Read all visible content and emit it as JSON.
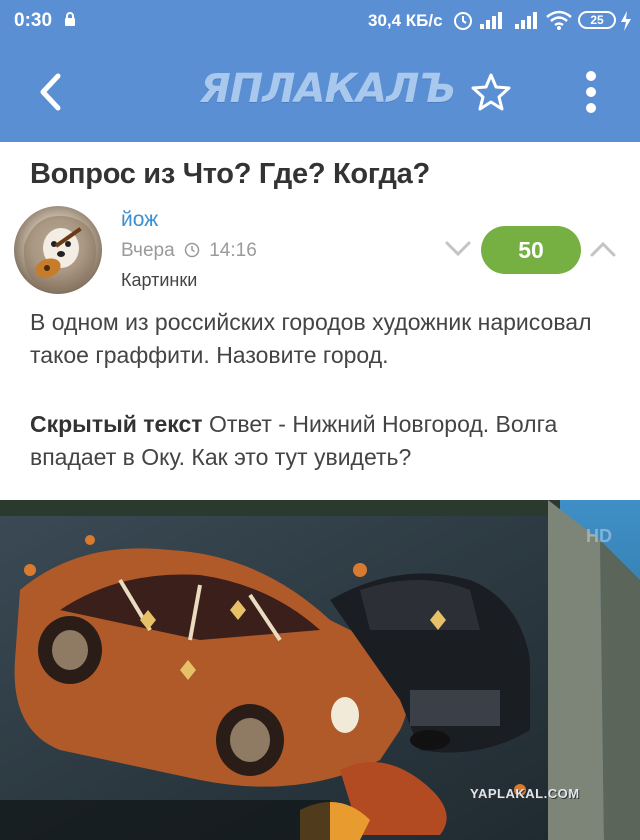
{
  "status_bar": {
    "time": "0:30",
    "speed": "30,4 КБ/с",
    "battery": "25",
    "icons": [
      "lock-icon",
      "alarm-icon",
      "signal-icon",
      "signal-icon",
      "wifi-icon",
      "battery-icon",
      "charging-icon"
    ]
  },
  "app_bar": {
    "logo": "ЯПЛАКАЛЪ",
    "icons": [
      "back-arrow-icon",
      "star-icon",
      "more-vert-icon"
    ]
  },
  "post": {
    "title": "Вопрос из Что? Где? Когда?",
    "author": "йож",
    "date": "Вчера",
    "time": "14:16",
    "category": "Картинки",
    "score": "50",
    "body": "В одном из российских городов художник нарисовал такое граффити. Назовите город.",
    "spoiler_label": "Скрытый текст",
    "spoiler_text": "Ответ - Нижний Новгород. Волга впадает в Оку. Как это тут увидеть?"
  },
  "image": {
    "watermark": "YAPLAKAL.COM",
    "corner_badge": "HD"
  },
  "colors": {
    "header": "#5b8fd3",
    "author_link": "#3b8fd0",
    "score_pill": "#76b043"
  }
}
